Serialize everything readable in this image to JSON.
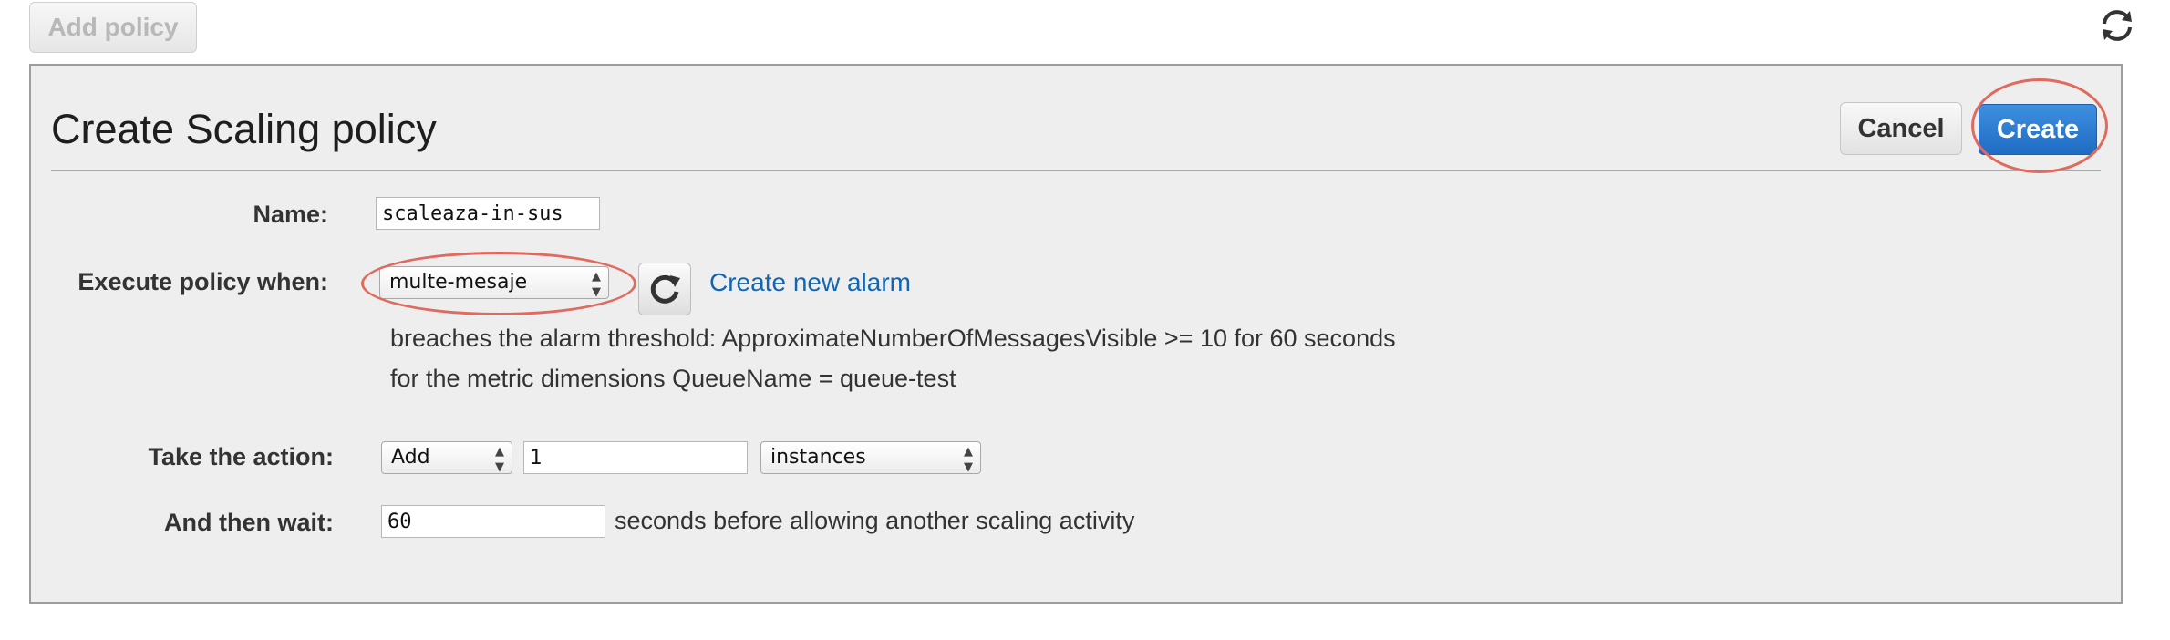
{
  "toolbar": {
    "add_policy_label": "Add policy"
  },
  "icons": {
    "top_refresh": "refresh-cycle-icon",
    "alarm_refresh": "refresh-icon"
  },
  "panel": {
    "title": "Create Scaling policy",
    "cancel_label": "Cancel",
    "create_label": "Create"
  },
  "form": {
    "name_label": "Name:",
    "name_value": "scaleaza-in-sus",
    "execute_label": "Execute policy when:",
    "alarm_selected": "multe-mesaje",
    "create_alarm_link": "Create new alarm",
    "breach_line1": "breaches the alarm threshold: ApproximateNumberOfMessagesVisible >= 10 for 60 seconds",
    "breach_line2": "for the metric dimensions QueueName = queue-test",
    "action_label": "Take the action:",
    "action_selected": "Add",
    "action_amount": "1",
    "action_unit_selected": "instances",
    "wait_label": "And then wait:",
    "wait_value": "60",
    "wait_suffix": "seconds before allowing another scaling activity"
  },
  "colors": {
    "primary_button": "#2b7bd3",
    "link": "#1265b0",
    "highlight_ring": "#e06a5e",
    "panel_bg": "#eeeeee"
  }
}
